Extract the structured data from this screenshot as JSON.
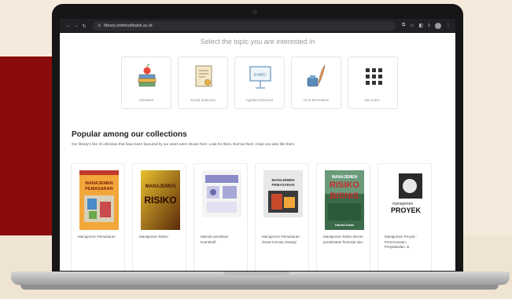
{
  "browser": {
    "url": "library.stimbudibakti.ac.id",
    "nav_back": "←",
    "nav_forward": "→",
    "nav_reload": "↻"
  },
  "topics": {
    "heading": "Select the topic you are interested in",
    "items": [
      {
        "label": "Literature",
        "icon": "apple-books-icon"
      },
      {
        "label": "Social Sciences",
        "icon": "certificate-icon"
      },
      {
        "label": "Applied Sciences",
        "icon": "presentation-board-icon"
      },
      {
        "label": "Art & Recreation",
        "icon": "ink-feather-icon"
      },
      {
        "label": "see more..",
        "icon": "grid-dots-icon"
      }
    ],
    "board_text": "E=MC²"
  },
  "popular": {
    "title": "Popular among our collections",
    "description": "Our library's line of collection that have been favoured by our users were shown here. Look for them. Borrow them. Hope you also like them",
    "books": [
      {
        "title": "Manajemen Pemasaran",
        "cover_text": [
          "MANAJEMEN",
          "PEMASARAN"
        ]
      },
      {
        "title": "Manajemen Risiko",
        "cover_text": [
          "MANAJEMEN",
          "RISIKO"
        ]
      },
      {
        "title": "Metode penelitian kuantitatif",
        "cover_text": []
      },
      {
        "title": "Manajemen Pemasaran : Dasar konsep strategi",
        "cover_text": [
          "MANAJEMEN",
          "PEMASARAN"
        ]
      },
      {
        "title": "Manajemen Risiko Bisnis: pendekatan finansial dan",
        "cover_text": [
          "MANAJEMEN",
          "RISIKO",
          "BISNIS",
          "Harold Umar"
        ]
      },
      {
        "title": "Manajemen Proyek : Perencanaan, Penjadwalan, &",
        "cover_text": [
          "manajemen",
          "PROYEK"
        ]
      }
    ]
  },
  "colors": {
    "accent_red": "#8a0b0b",
    "background": "#f6eadc"
  }
}
